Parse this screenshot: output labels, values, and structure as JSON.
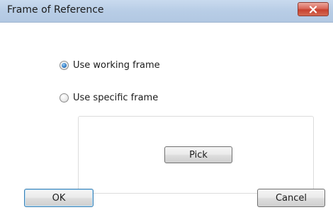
{
  "window": {
    "title": "Frame of Reference"
  },
  "options": [
    {
      "label": "Use working frame",
      "selected": true
    },
    {
      "label": "Use specific frame",
      "selected": false
    }
  ],
  "group": {
    "pick_label": "Pick"
  },
  "buttons": {
    "ok_label": "OK",
    "cancel_label": "Cancel"
  },
  "colors": {
    "titlebar": "#b8cde6",
    "close_button": "#c7412f",
    "default_button_border": "#3c7fb1"
  },
  "icons": {
    "close": "close-icon"
  }
}
